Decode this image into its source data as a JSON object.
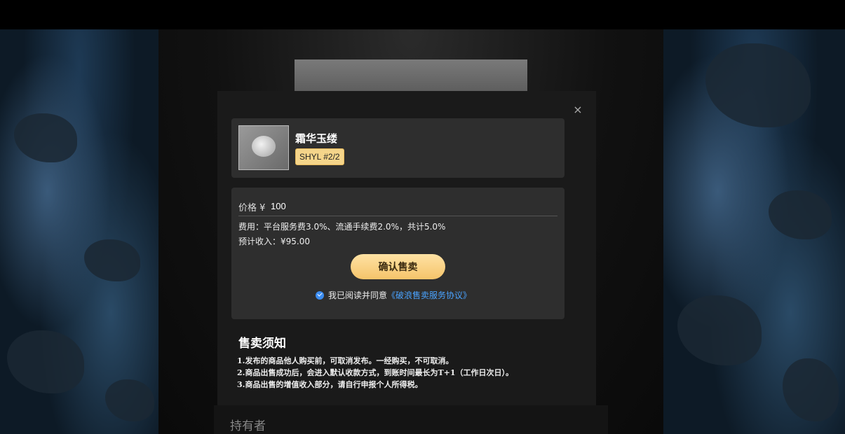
{
  "item": {
    "name": "霜华玉缕",
    "tag": "SHYL #2/2"
  },
  "price": {
    "label": "价格 ¥",
    "value": "100"
  },
  "fee_text": "费用：平台服务费3.0%、流通手续费2.0%，共计5.0%",
  "income_text": "预计收入：¥95.00",
  "confirm_button": "确认售卖",
  "agreement": {
    "prefix": "我已阅读并同意",
    "link": "《破浪售卖服务协议》",
    "checked": true
  },
  "notice": {
    "title": "售卖须知",
    "lines": [
      "1.发布的商品他人购买前，可取消发布。一经购买，不可取消。",
      "2.商品出售成功后，会进入默认收款方式，到账时间最长为T+1（工作日次日）。",
      "3.商品出售的增值收入部分，请自行申报个人所得税。"
    ]
  },
  "holder_label": "持有者",
  "close_label": "×",
  "colors": {
    "accent_gold": "#f5c46a",
    "link_blue": "#4aa3ff",
    "check_blue": "#3b8cf0"
  }
}
